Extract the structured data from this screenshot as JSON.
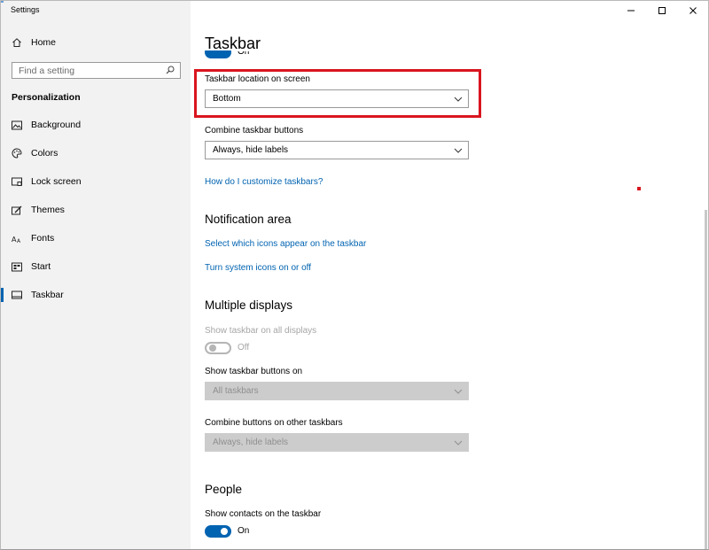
{
  "window": {
    "app_title": "Settings",
    "controls": [
      "minimize",
      "maximize",
      "close"
    ]
  },
  "sidebar": {
    "home_label": "Home",
    "search_placeholder": "Find a setting",
    "section_title": "Personalization",
    "items": [
      {
        "label": "Background",
        "icon": "picture-icon"
      },
      {
        "label": "Colors",
        "icon": "palette-icon"
      },
      {
        "label": "Lock screen",
        "icon": "lock-screen-icon"
      },
      {
        "label": "Themes",
        "icon": "brush-icon"
      },
      {
        "label": "Fonts",
        "icon": "font-icon"
      },
      {
        "label": "Start",
        "icon": "start-icon"
      },
      {
        "label": "Taskbar",
        "icon": "taskbar-icon",
        "active": true
      }
    ]
  },
  "main": {
    "title": "Taskbar",
    "top_toggle_label": "On",
    "location": {
      "label": "Taskbar location on screen",
      "value": "Bottom"
    },
    "combine": {
      "label": "Combine taskbar buttons",
      "value": "Always, hide labels"
    },
    "customize_link": "How do I customize taskbars?",
    "notification": {
      "title": "Notification area",
      "link_icons": "Select which icons appear on the taskbar",
      "link_system": "Turn system icons on or off"
    },
    "multiple_displays": {
      "title": "Multiple displays",
      "show_all_label": "Show taskbar on all displays",
      "show_all_state": "Off",
      "buttons_on_label": "Show taskbar buttons on",
      "buttons_on_value": "All taskbars",
      "combine_other_label": "Combine buttons on other taskbars",
      "combine_other_value": "Always, hide labels"
    },
    "people": {
      "title": "People",
      "contacts_label": "Show contacts on the taskbar",
      "contacts_state": "On"
    }
  },
  "colors": {
    "accent": "#0063b1",
    "highlight": "#d9151f",
    "sidebar_bg": "#f2f2f2"
  }
}
